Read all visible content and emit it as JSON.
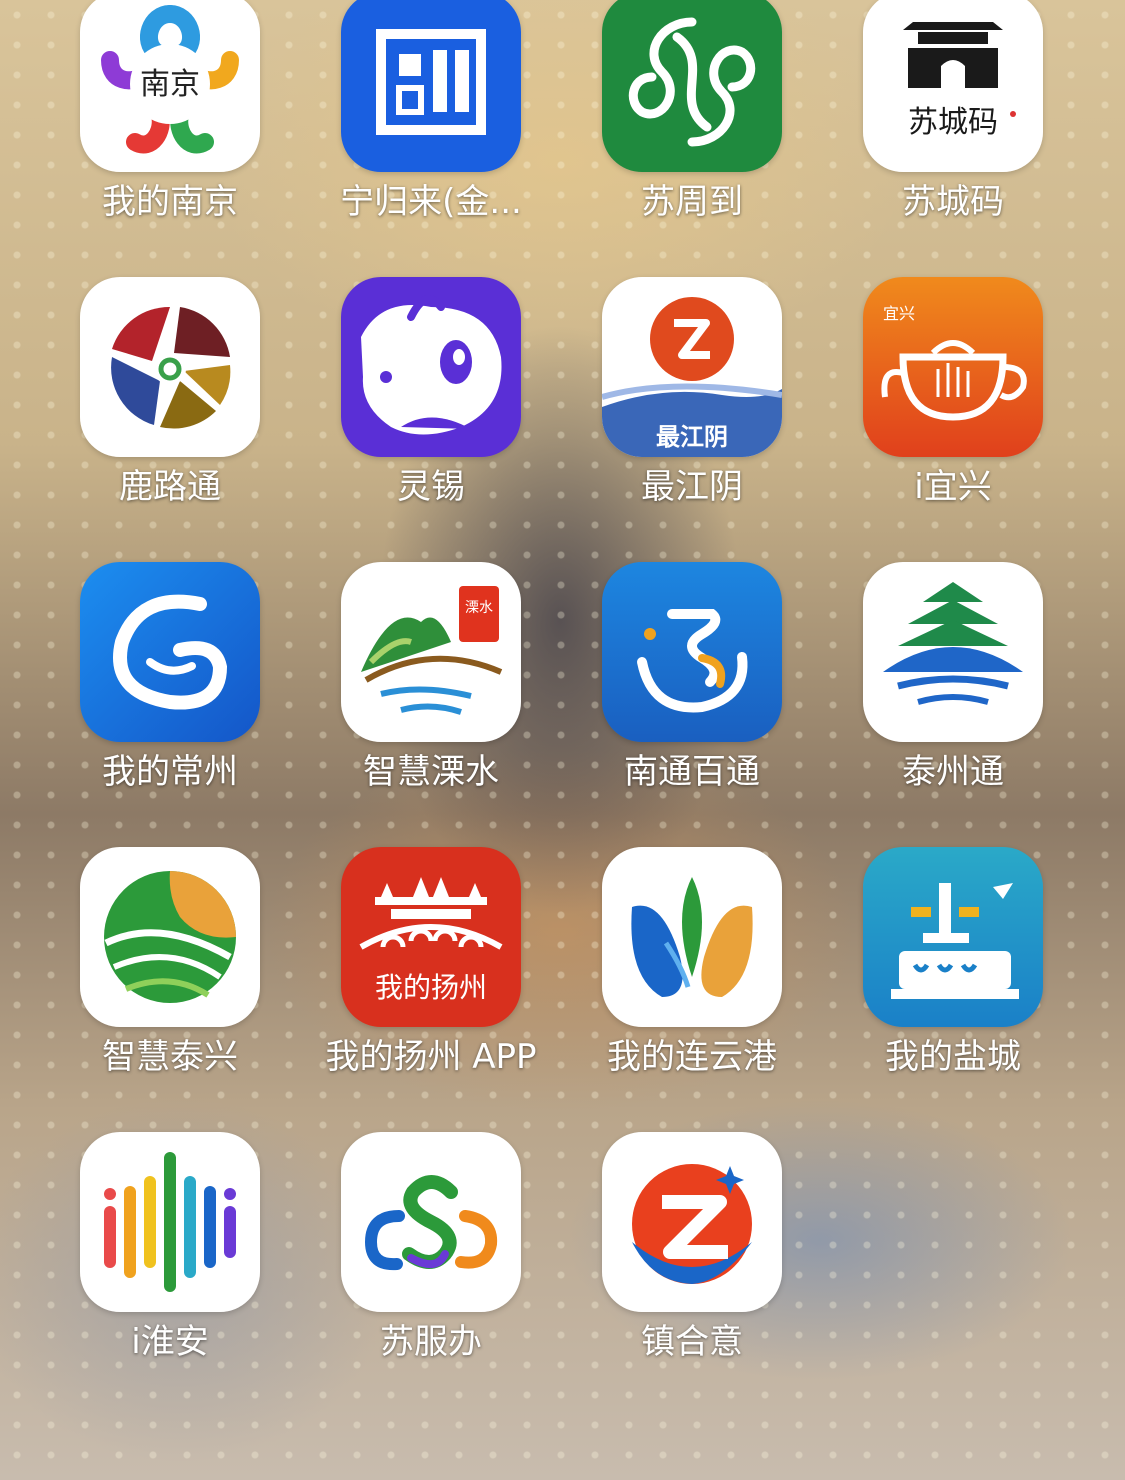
{
  "apps": [
    {
      "label": "我的南京",
      "icon": "my-nanjing-icon",
      "icon_text": "南京"
    },
    {
      "label": "宁归来(金...",
      "icon": "ning-gui-lai-icon"
    },
    {
      "label": "苏周到",
      "icon": "su-zhou-dao-icon"
    },
    {
      "label": "苏城码",
      "icon": "su-cheng-ma-icon",
      "icon_text": "苏城码"
    },
    {
      "label": "鹿路通",
      "icon": "lu-lu-tong-icon"
    },
    {
      "label": "灵锡",
      "icon": "ling-xi-icon"
    },
    {
      "label": "最江阴",
      "icon": "zui-jiangyin-icon",
      "icon_text": "最江阴"
    },
    {
      "label": "i宜兴",
      "icon": "i-yixing-icon",
      "icon_text": "宜兴"
    },
    {
      "label": "我的常州",
      "icon": "my-changzhou-icon"
    },
    {
      "label": "智慧溧水",
      "icon": "zhihui-lishui-icon",
      "icon_text": "溧水"
    },
    {
      "label": "南通百通",
      "icon": "nantong-baitong-icon"
    },
    {
      "label": "泰州通",
      "icon": "taizhou-tong-icon"
    },
    {
      "label": "智慧泰兴",
      "icon": "zhihui-taixing-icon"
    },
    {
      "label": "我的扬州 APP",
      "icon": "my-yangzhou-icon",
      "icon_text": "我的扬州"
    },
    {
      "label": "我的连云港",
      "icon": "my-lianyungang-icon"
    },
    {
      "label": "我的盐城",
      "icon": "my-yancheng-icon"
    },
    {
      "label": "i淮安",
      "icon": "i-huaian-icon"
    },
    {
      "label": "苏服办",
      "icon": "su-fu-ban-icon"
    },
    {
      "label": "镇合意",
      "icon": "zhen-he-yi-icon"
    }
  ]
}
